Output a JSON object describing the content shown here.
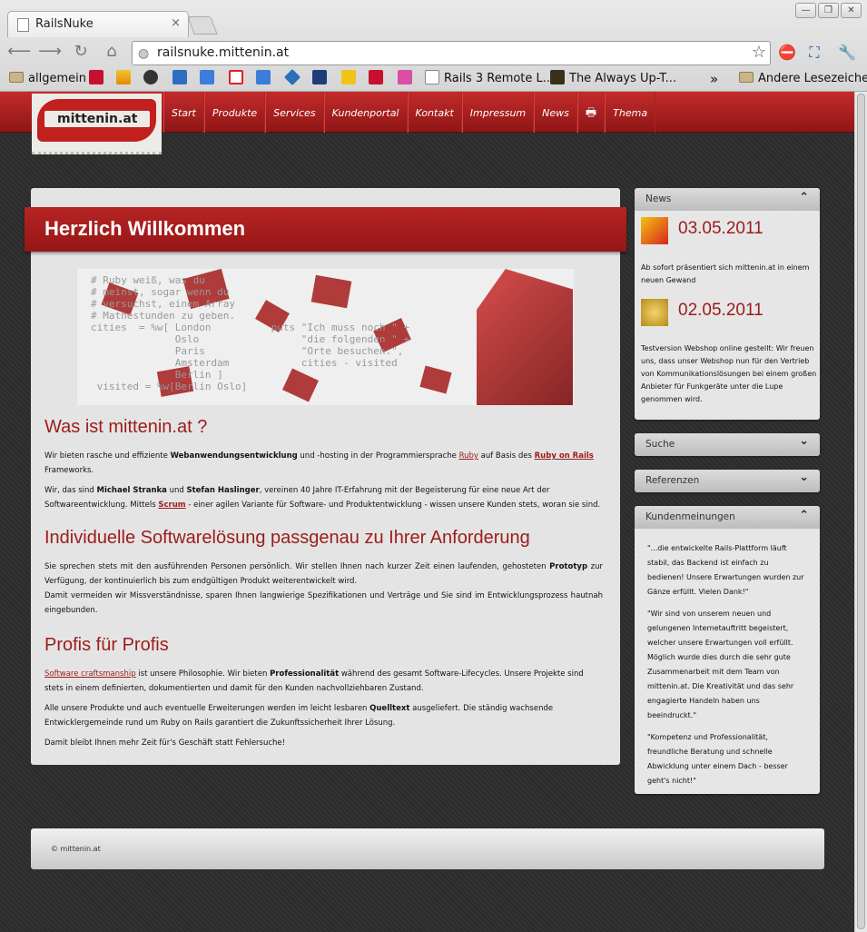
{
  "browser": {
    "tab_title": "RailsNuke",
    "tab_close": "×",
    "window_buttons": [
      "—",
      "❐",
      "✕"
    ],
    "url": "railsnuke.mittenin.at",
    "bookmarks": [
      {
        "label": "allgemein",
        "icon": "folder-icon"
      },
      {
        "label": "Rails 3 Remote L...",
        "icon": "page-icon"
      },
      {
        "label": "The Always Up-T...",
        "icon": "lh-icon"
      },
      {
        "label": "»",
        "icon": ""
      },
      {
        "label": "Andere Lesezeichen",
        "icon": "folder-icon"
      }
    ]
  },
  "site": {
    "logo_text": "mittenin.at",
    "menu": [
      "Start",
      "Produkte",
      "Services",
      "Kundenportal",
      "Kontakt",
      "Impressum",
      "News",
      "🖶",
      "Thema"
    ],
    "welcome_title": "Herzlich Willkommen",
    "hero_code": "# Ruby weiß, was du\n# meinst, sogar wenn du\n# versuchst, einem Array\n# Mathestunden zu geben.\ncities  = %w[ London          puts \"Ich muss noch \" +\n              Oslo                 \"die folgenden \" +\n              Paris                \"Orte besuchen:\",\n              Amsterdam            cities - visited\n              Berlin ]\n visited = %w[Berlin Oslo]",
    "s1_title": "Was ist mittenin.at ?",
    "s1_p1_a": "Wir bieten rasche und effiziente ",
    "s1_p1_b": "Webanwendungsentwicklung",
    "s1_p1_c": " und -hosting in der Programmiersprache ",
    "s1_p1_ruby": "Ruby",
    "s1_p1_d": " auf Basis des ",
    "s1_p1_ror": "Ruby on Rails",
    "s1_p1_e": " Frameworks.",
    "s1_p2_a": "Wir, das sind ",
    "s1_p2_b": "Michael Stranka",
    "s1_p2_c": " und ",
    "s1_p2_d": "Stefan Haslinger",
    "s1_p2_e": ", vereinen 40 Jahre IT-Erfahrung mit der Begeisterung für eine neue Art der Softwareentwicklung. Mittels ",
    "s1_p2_scrum": "Scrum",
    "s1_p2_f": " - einer agilen Variante für Software- und Produktentwicklung - wissen unsere Kunden stets, woran sie sind.",
    "s2_title": "Individuelle Softwarelösung passgenau zu Ihrer Anforderung",
    "s2_p1_a": "Sie sprechen stets mit den ausführenden Personen persönlich. Wir stellen Ihnen nach kurzer Zeit einen laufenden, gehosteten ",
    "s2_p1_b": "Prototyp",
    "s2_p1_c": " zur Verfügung, der kontinuierlich bis zum endgültigen Produkt weiterentwickelt wird.",
    "s2_p2": "Damit vermeiden wir Missverständnisse, sparen Ihnen langwierige Spezifikationen und Verträge und Sie sind im Entwicklungsprozess hautnah eingebunden.",
    "s3_title": "Profis für Profis",
    "s3_p1_link": "Software craftsmanship",
    "s3_p1_a": " ist unsere Philosophie. Wir bieten ",
    "s3_p1_b": "Professionalität",
    "s3_p1_c": " während des gesamt Software-Lifecycles. Unsere Projekte sind stets in einem definierten, dokumentierten und damit für den Kunden nachvollziehbaren Zustand.",
    "s3_p2_a": "Alle unsere Produkte und auch eventuelle Erweiterungen werden im leicht lesbaren ",
    "s3_p2_b": "Quelltext",
    "s3_p2_c": " ausgeliefert. Die ständig wachsende Entwicklergemeinde rund um Ruby on Rails garantiert die Zukunftssicherheit Ihrer Lösung.",
    "s3_p3": "Damit bleibt Ihnen mehr Zeit für's Geschäft statt Fehlersuche!",
    "footer": "© mittenin.at"
  },
  "sidebar": {
    "news_title": "News",
    "news": [
      {
        "date": "03.05.2011",
        "text": "Ab sofort präsentiert sich mittenin.at in einem neuen Gewand",
        "icon": "news-icon"
      },
      {
        "date": "02.05.2011",
        "text": "Testversion Webshop online gestellt: Wir freuen uns, dass unser Webshop nun für den Vertrieb von Kommunikationslösungen bei einem großen Anbieter für Funkgeräte unter die Lupe genommen wird.",
        "icon": "trophy-icon"
      }
    ],
    "search_title": "Suche",
    "refs_title": "Referenzen",
    "testimonials_title": "Kundenmeinungen",
    "testimonials": [
      "\"...die entwickelte Rails-Plattform läuft stabil, das Backend ist einfach zu bedienen! Unsere Erwartungen wurden zur Gänze erfüllt. Vielen Dank!\"",
      "\"Wir sind von unserem neuen und gelungenen Internetauftritt begeistert, welcher unsere Erwartungen voll erfüllt. Möglich wurde dies durch die sehr gute Zusammenarbeit mit dem Team von mittenin.at. Die Kreativität und das sehr engagierte Handeln haben uns beeindruckt.\"",
      "\"Kompetenz und Professionalität, freundliche Beratung und schnelle Abwicklung unter einem Dach - besser geht's nicht!\""
    ],
    "chevron_up": "⌃",
    "chevron_down": "⌄"
  },
  "colors": {
    "brand_red": "#9d1b1b",
    "nav_red": "#b72424"
  }
}
